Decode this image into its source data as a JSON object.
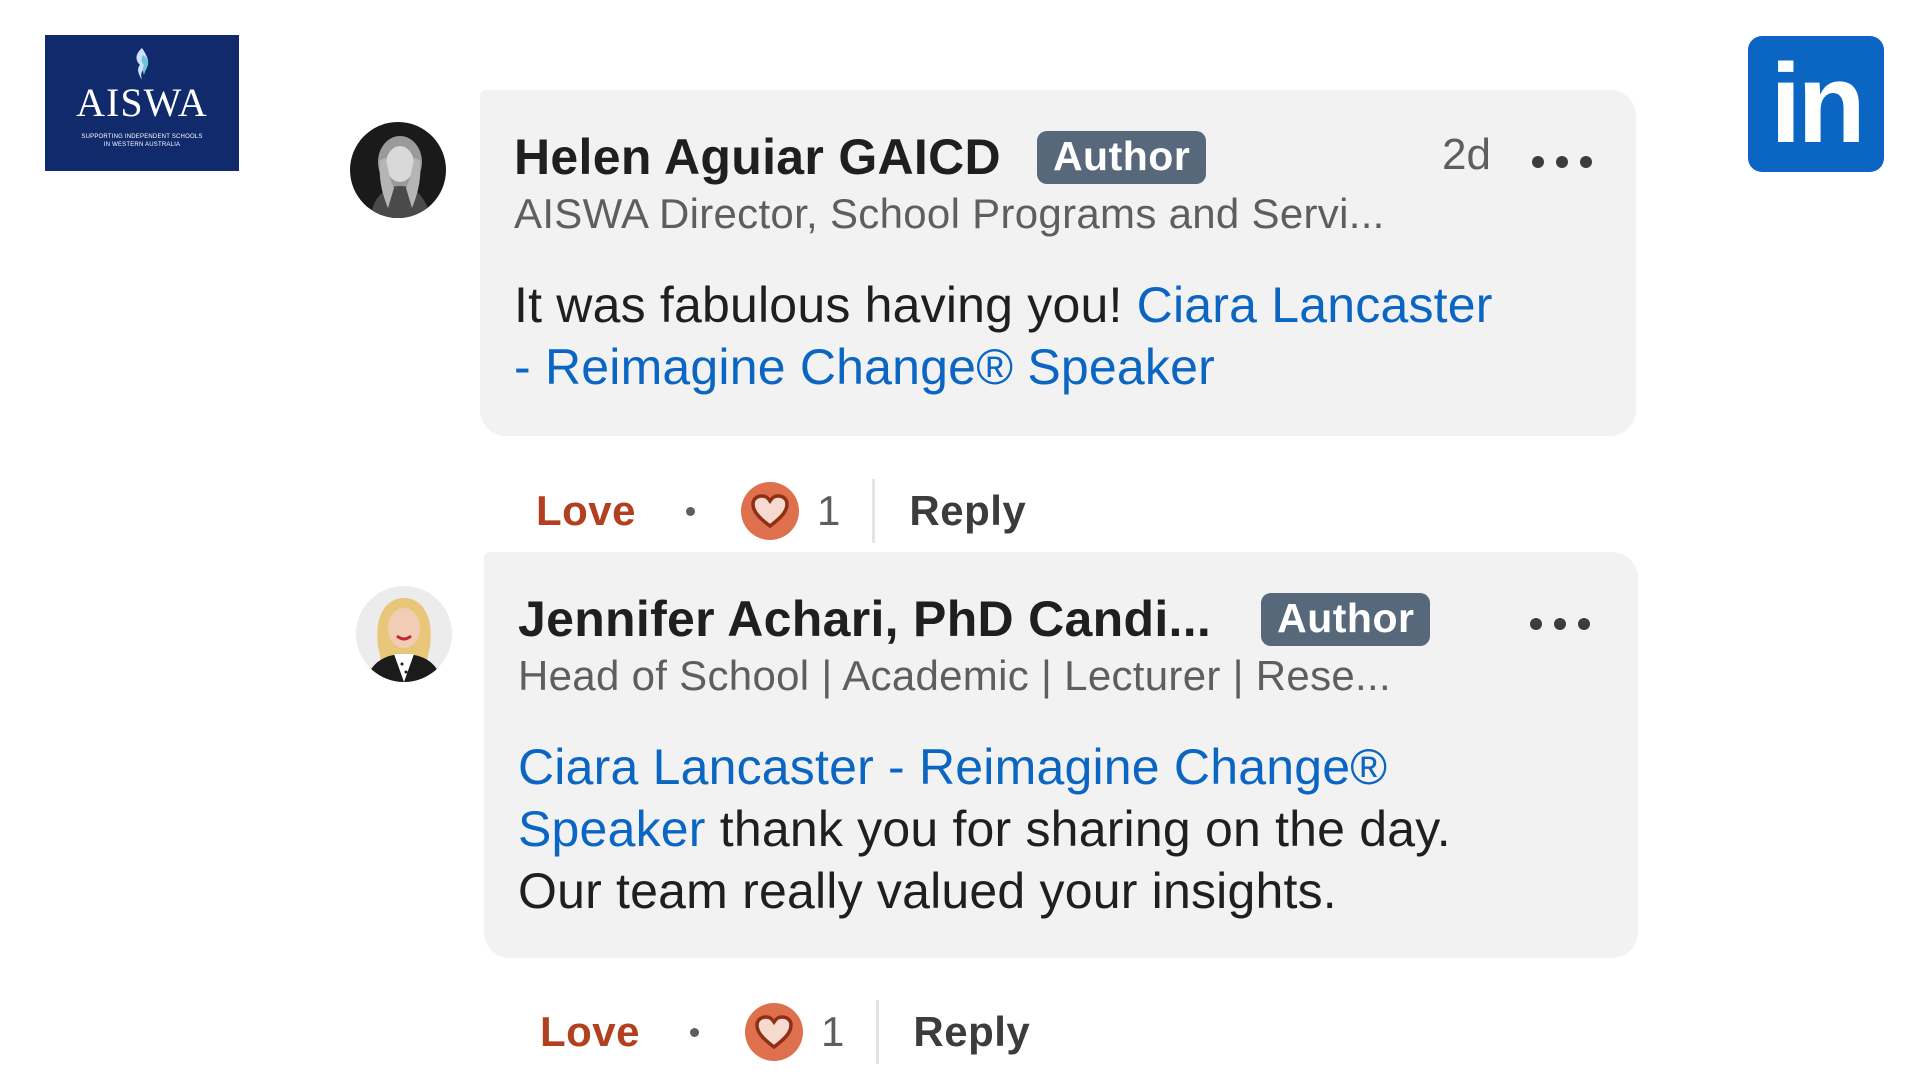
{
  "logos": {
    "aiswa": {
      "name": "AISWA",
      "tagline_1": "SUPPORTING INDEPENDENT SCHOOLS",
      "tagline_2": "in WESTERN AUSTRALIA",
      "bg_color": "#102a6b"
    },
    "linkedin": {
      "text": "in",
      "bg_color": "#0a66c2"
    }
  },
  "comments": [
    {
      "author": "Helen Aguiar GAICD",
      "badge": "Author",
      "time": "2d",
      "headline": "AISWA Director, School Programs and Servi...",
      "text_before": "It was fabulous having you! ",
      "mention_line1": "Ciara Lancaster",
      "mention_line2": "- Reimagine Change® Speaker",
      "actions": {
        "love": "Love",
        "reaction_count": "1",
        "reply": "Reply"
      }
    },
    {
      "author": "Jennifer Achari, PhD Candi...",
      "badge": "Author",
      "headline": "Head of School | Academic | Lecturer | Rese...",
      "mention_line1": "Ciara Lancaster - Reimagine Change®",
      "mention_line2": "Speaker",
      "text_after_line2": " thank you for sharing on the day.",
      "text_line3": "Our team really valued your insights.",
      "actions": {
        "love": "Love",
        "reaction_count": "1",
        "reply": "Reply"
      }
    }
  ],
  "colors": {
    "mention": "#0a66c2",
    "love": "#b24020",
    "reaction": "#df704d",
    "badge": "#56687a",
    "bubble": "#f2f2f2"
  }
}
